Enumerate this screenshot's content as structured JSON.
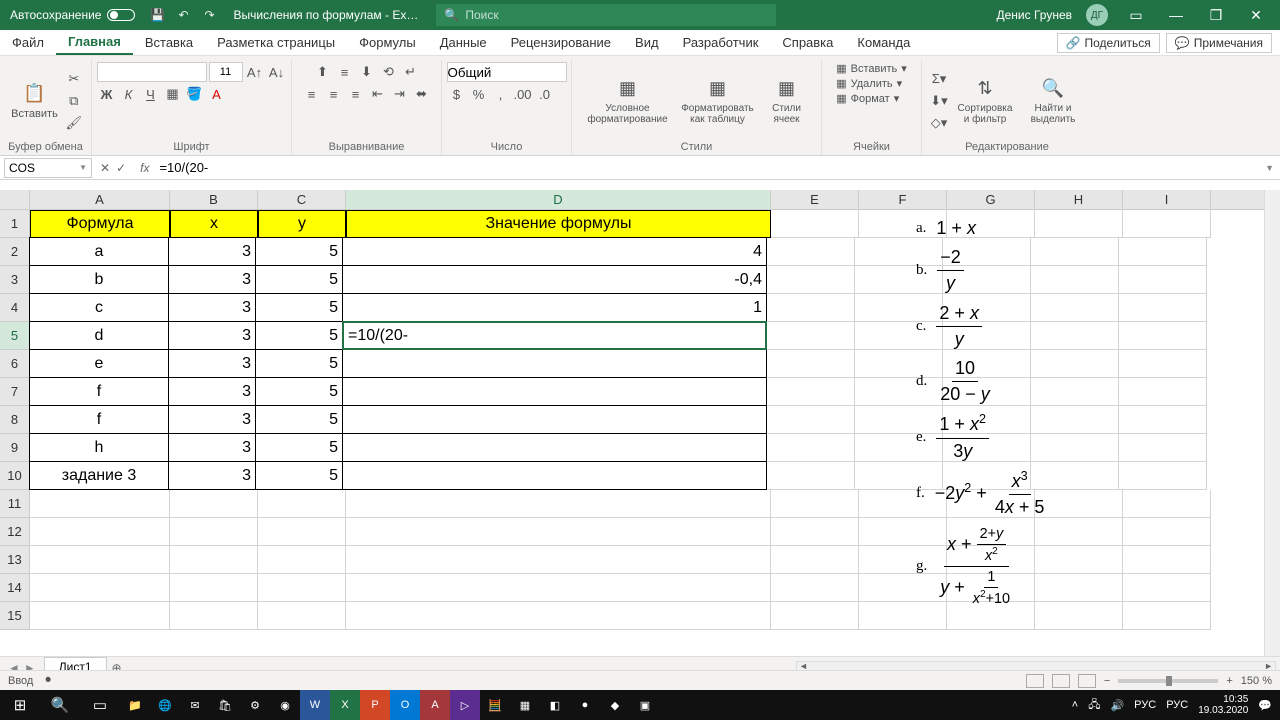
{
  "titlebar": {
    "autosave": "Автосохранение",
    "doc_title": "Вычисления по формулам - Ex…",
    "search_placeholder": "Поиск",
    "user_name": "Денис Грунев",
    "user_initials": "ДГ"
  },
  "tabs": {
    "file": "Файл",
    "home": "Главная",
    "insert": "Вставка",
    "layout": "Разметка страницы",
    "formulas": "Формулы",
    "data": "Данные",
    "review": "Рецензирование",
    "view": "Вид",
    "developer": "Разработчик",
    "help": "Справка",
    "team": "Команда",
    "share": "Поделиться",
    "comments": "Примечания"
  },
  "ribbon": {
    "clipboard": {
      "paste": "Вставить",
      "label": "Буфер обмена"
    },
    "font": {
      "size": "11",
      "label": "Шрифт"
    },
    "align": {
      "label": "Выравнивание"
    },
    "number": {
      "format": "Общий",
      "label": "Число"
    },
    "styles": {
      "cond": "Условное форматирование",
      "table": "Форматировать как таблицу",
      "cell": "Стили ячеек",
      "label": "Стили"
    },
    "cells": {
      "insert": "Вставить",
      "delete": "Удалить",
      "format": "Формат",
      "label": "Ячейки"
    },
    "editing": {
      "sort": "Сортировка и фильтр",
      "find": "Найти и выделить",
      "label": "Редактирование"
    }
  },
  "fbar": {
    "name": "COS",
    "formula": "=10/(20-"
  },
  "columns": [
    "A",
    "B",
    "C",
    "D",
    "E",
    "F",
    "G",
    "H",
    "I"
  ],
  "sheet": {
    "h1": "Формула",
    "h2": "x",
    "h3": "y",
    "h4": "Значение формулы",
    "rows": [
      {
        "a": "a",
        "b": "3",
        "c": "5",
        "d": "4"
      },
      {
        "a": "b",
        "b": "3",
        "c": "5",
        "d": "-0,4"
      },
      {
        "a": "c",
        "b": "3",
        "c": "5",
        "d": "1"
      },
      {
        "a": "d",
        "b": "3",
        "c": "5",
        "d": "=10/(20-"
      },
      {
        "a": "e",
        "b": "3",
        "c": "5",
        "d": ""
      },
      {
        "a": "f",
        "b": "3",
        "c": "5",
        "d": ""
      },
      {
        "a": "f",
        "b": "3",
        "c": "5",
        "d": ""
      },
      {
        "a": "h",
        "b": "3",
        "c": "5",
        "d": ""
      },
      {
        "a": "задание 3",
        "b": "3",
        "c": "5",
        "d": ""
      }
    ]
  },
  "sheettab": "Лист1",
  "status": {
    "mode": "Ввод",
    "zoom": "150 %"
  },
  "taskbar": {
    "lang1": "РУС",
    "lang2": "РУС",
    "time": "10:35",
    "date": "19.03.2020"
  }
}
